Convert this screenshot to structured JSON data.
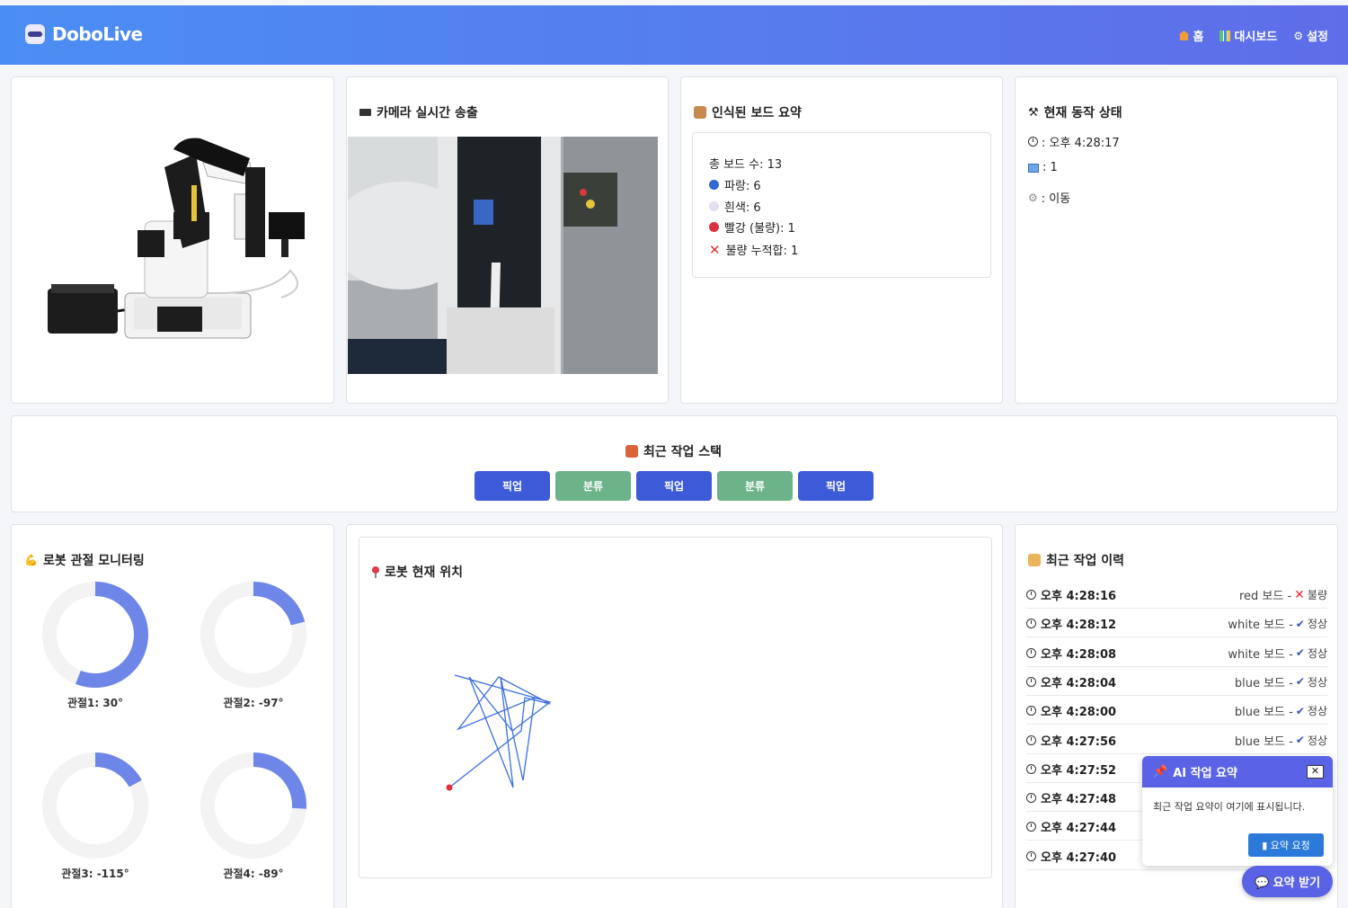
{
  "header": {
    "brand": "DoboLive",
    "nav": [
      {
        "icon": "house-icon",
        "label": "홈"
      },
      {
        "icon": "bar-chart-icon",
        "label": "대시보드"
      },
      {
        "icon": "gear-icon",
        "label": "설정"
      }
    ]
  },
  "camera": {
    "title": "카메라 실시간 송출"
  },
  "summary": {
    "title": "인식된 보드 요약",
    "total": "총 보드 수: 13",
    "blue": "파랑: 6",
    "white": "흰색: 6",
    "red": "빨강 (불량): 1",
    "defect_total": "불량 누적합: 1"
  },
  "status": {
    "title": "현재 동작 상태",
    "time": ": 오후 4:28:17",
    "count": ": 1",
    "action": ": 이동"
  },
  "stack": {
    "title": "최근 작업 스택",
    "items": [
      {
        "label": "픽업",
        "kind": "pick"
      },
      {
        "label": "분류",
        "kind": "sort"
      },
      {
        "label": "픽업",
        "kind": "pick"
      },
      {
        "label": "분류",
        "kind": "sort"
      },
      {
        "label": "픽업",
        "kind": "pick"
      }
    ]
  },
  "joints": {
    "title": "로봇 관절 모니터링",
    "items": [
      {
        "label": "관절1: 30°",
        "value": 30,
        "fraction": 0.56
      },
      {
        "label": "관절2: -97°",
        "value": -97,
        "fraction": 0.21
      },
      {
        "label": "관절3: -115°",
        "value": -115,
        "fraction": 0.17
      },
      {
        "label": "관절4: -89°",
        "value": -89,
        "fraction": 0.26
      }
    ],
    "color": "#6e86e8"
  },
  "position": {
    "title": "로봇 현재 위치"
  },
  "history": {
    "title": "최근 작업 이력",
    "rows": [
      {
        "time": "오후 4:28:16",
        "result": "red 보드 -",
        "status": "불량",
        "mark": "x"
      },
      {
        "time": "오후 4:28:12",
        "result": "white 보드 -",
        "status": "정상",
        "mark": "check"
      },
      {
        "time": "오후 4:28:08",
        "result": "white 보드 -",
        "status": "정상",
        "mark": "check"
      },
      {
        "time": "오후 4:28:04",
        "result": "blue 보드 -",
        "status": "정상",
        "mark": "check"
      },
      {
        "time": "오후 4:28:00",
        "result": "blue 보드 -",
        "status": "정상",
        "mark": "check"
      },
      {
        "time": "오후 4:27:56",
        "result": "blue 보드 -",
        "status": "정상",
        "mark": "check"
      },
      {
        "time": "오후 4:27:52",
        "result": "",
        "status": "",
        "mark": ""
      },
      {
        "time": "오후 4:27:48",
        "result": "",
        "status": "",
        "mark": ""
      },
      {
        "time": "오후 4:27:44",
        "result": "",
        "status": "",
        "mark": ""
      },
      {
        "time": "오후 4:27:40",
        "result": "",
        "status": "",
        "mark": ""
      }
    ]
  },
  "ai_popup": {
    "title": "AI 작업 요약",
    "close": "✕",
    "text": "최근 작업 요약이 여기에 표시됩니다.",
    "request_button": "요약 요청"
  },
  "fab": {
    "label": "요약 받기"
  },
  "colors": {
    "accent": "#5a63e6",
    "pick": "#3d5bd9",
    "sort": "#6cb38a",
    "defect": "#e0303a",
    "ok": "#3a4fc9"
  }
}
